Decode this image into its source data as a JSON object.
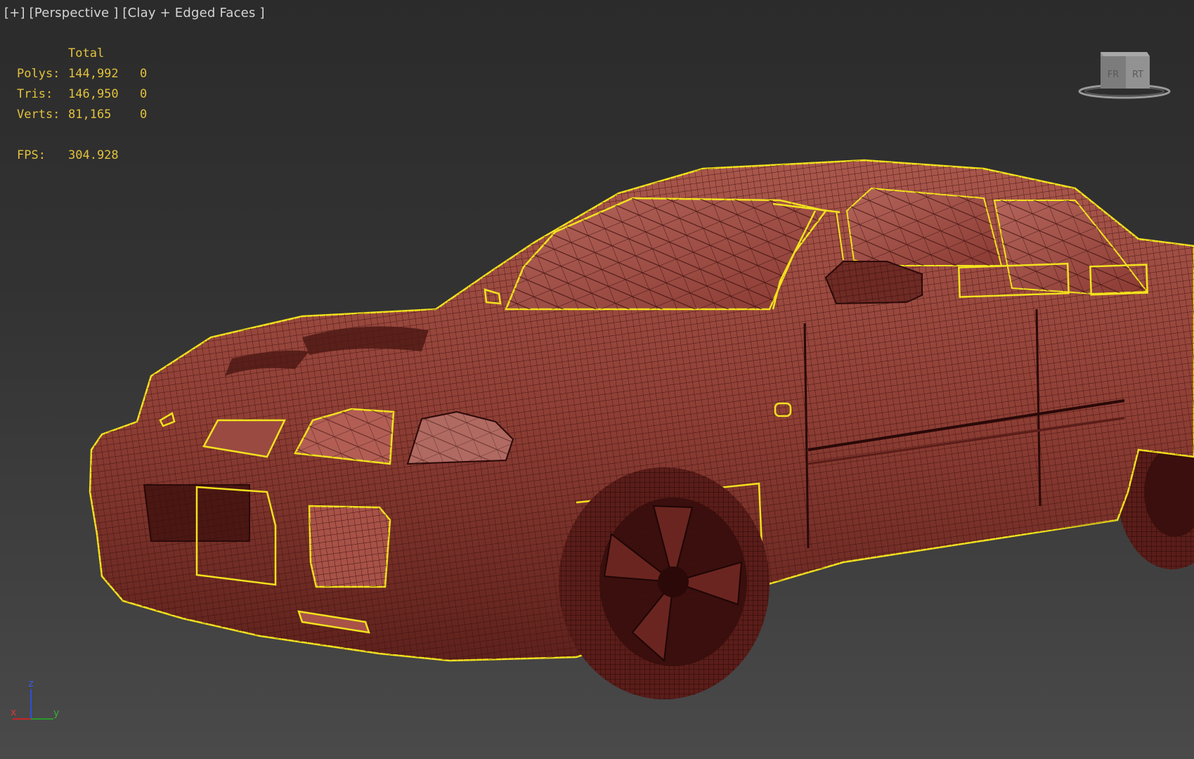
{
  "viewport": {
    "label_plus": "[+]",
    "label_view": "[Perspective ]",
    "label_shading": "[Clay + Edged Faces ]"
  },
  "stats": {
    "header": "Total",
    "rows": [
      {
        "label": "Polys:",
        "total": "144,992",
        "selected": "0"
      },
      {
        "label": "Tris:",
        "total": "146,950",
        "selected": "0"
      },
      {
        "label": "Verts:",
        "total": "81,165",
        "selected": "0"
      }
    ],
    "fps_label": "FPS:",
    "fps_value": "304.928"
  },
  "viewcube": {
    "icon": "viewcube-icon",
    "left_face": "FR",
    "right_face": "RT"
  },
  "axis": {
    "icon": "axis-tripod-icon",
    "x": "x",
    "y": "y",
    "z": "z"
  },
  "colors": {
    "selection_outline": "#f2e21e",
    "clay": "#8a3a32",
    "wire": "#3a0e0c",
    "stats_text": "#e2c23e",
    "label_text": "#d4d4d4"
  }
}
